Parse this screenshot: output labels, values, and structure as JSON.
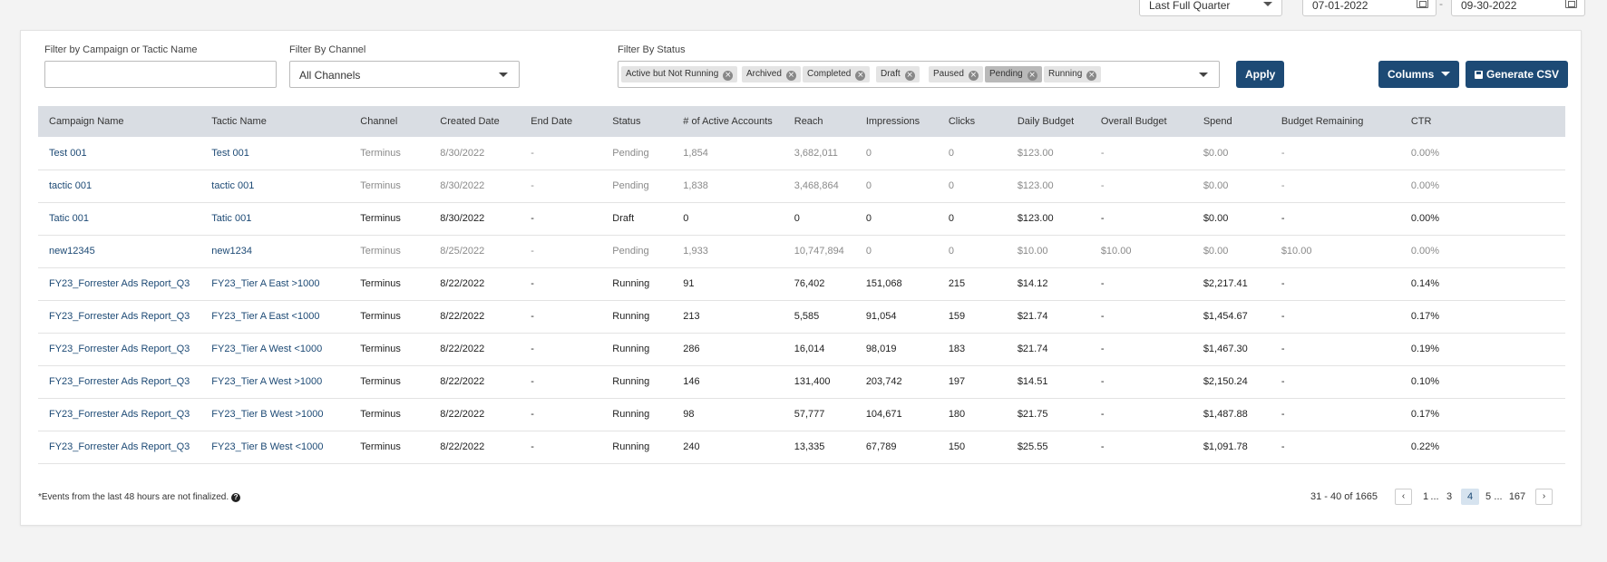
{
  "top": {
    "period": "Last Full Quarter",
    "start_date": "07-01-2022",
    "date_separator": "-",
    "end_date": "09-30-2022"
  },
  "filters": {
    "campaign_label": "Filter by Campaign or Tactic Name",
    "campaign_value": "",
    "channel_label": "Filter By Channel",
    "channel_value": "All Channels",
    "status_label": "Filter By Status",
    "status_chips": [
      "Active but Not Running",
      "Archived",
      "Completed",
      "Draft",
      "Paused",
      "Pending",
      "Running"
    ],
    "apply_label": "Apply",
    "columns_label": "Columns",
    "csv_label": "Generate CSV"
  },
  "table": {
    "headers": [
      "Campaign Name",
      "Tactic Name",
      "Channel",
      "Created Date",
      "End Date",
      "Status",
      "# of Active Accounts",
      "Reach",
      "Impressions",
      "Clicks",
      "Daily Budget",
      "Overall Budget",
      "Spend",
      "Budget Remaining",
      "CTR"
    ],
    "rows": [
      [
        "Test 001",
        "Test 001",
        "Terminus",
        "8/30/2022",
        "-",
        "Pending",
        "1,854",
        "3,682,011",
        "0",
        "0",
        "$123.00",
        "-",
        "$0.00",
        "-",
        "0.00%"
      ],
      [
        "tactic 001",
        "tactic 001",
        "Terminus",
        "8/30/2022",
        "-",
        "Pending",
        "1,838",
        "3,468,864",
        "0",
        "0",
        "$123.00",
        "-",
        "$0.00",
        "-",
        "0.00%"
      ],
      [
        "Tatic 001",
        "Tatic 001",
        "Terminus",
        "8/30/2022",
        "-",
        "Draft",
        "0",
        "0",
        "0",
        "0",
        "$123.00",
        "-",
        "$0.00",
        "-",
        "0.00%"
      ],
      [
        "new12345",
        "new1234",
        "Terminus",
        "8/25/2022",
        "-",
        "Pending",
        "1,933",
        "10,747,894",
        "0",
        "0",
        "$10.00",
        "$10.00",
        "$0.00",
        "$10.00",
        "0.00%"
      ],
      [
        "FY23_Forrester Ads Report_Q3",
        "FY23_Tier A East >1000",
        "Terminus",
        "8/22/2022",
        "-",
        "Running",
        "91",
        "76,402",
        "151,068",
        "215",
        "$14.12",
        "-",
        "$2,217.41",
        "-",
        "0.14%"
      ],
      [
        "FY23_Forrester Ads Report_Q3",
        "FY23_Tier A East <1000",
        "Terminus",
        "8/22/2022",
        "-",
        "Running",
        "213",
        "5,585",
        "91,054",
        "159",
        "$21.74",
        "-",
        "$1,454.67",
        "-",
        "0.17%"
      ],
      [
        "FY23_Forrester Ads Report_Q3",
        "FY23_Tier A West <1000",
        "Terminus",
        "8/22/2022",
        "-",
        "Running",
        "286",
        "16,014",
        "98,019",
        "183",
        "$21.74",
        "-",
        "$1,467.30",
        "-",
        "0.19%"
      ],
      [
        "FY23_Forrester Ads Report_Q3",
        "FY23_Tier A West >1000",
        "Terminus",
        "8/22/2022",
        "-",
        "Running",
        "146",
        "131,400",
        "203,742",
        "197",
        "$14.51",
        "-",
        "$2,150.24",
        "-",
        "0.10%"
      ],
      [
        "FY23_Forrester Ads Report_Q3",
        "FY23_Tier B West >1000",
        "Terminus",
        "8/22/2022",
        "-",
        "Running",
        "98",
        "57,777",
        "104,671",
        "180",
        "$21.75",
        "-",
        "$1,487.88",
        "-",
        "0.17%"
      ],
      [
        "FY23_Forrester Ads Report_Q3",
        "FY23_Tier B West <1000",
        "Terminus",
        "8/22/2022",
        "-",
        "Running",
        "240",
        "13,335",
        "67,789",
        "150",
        "$25.55",
        "-",
        "$1,091.78",
        "-",
        "0.22%"
      ]
    ],
    "muted_rows": [
      0,
      1,
      3
    ]
  },
  "footer": {
    "note": "*Events from the last 48 hours are not finalized.",
    "help_glyph": "?",
    "range": "31 - 40 of 1665",
    "pages": [
      "1",
      "...",
      "3",
      "4",
      "5",
      "...",
      "167"
    ],
    "current_page": "4",
    "prev_glyph": "‹",
    "next_glyph": "›"
  },
  "colors": {
    "primary": "#1d4a75",
    "header_bg": "#d9dde3",
    "chip_bg": "#e4e4e4",
    "chip_active_bg": "#b9b9b9"
  }
}
